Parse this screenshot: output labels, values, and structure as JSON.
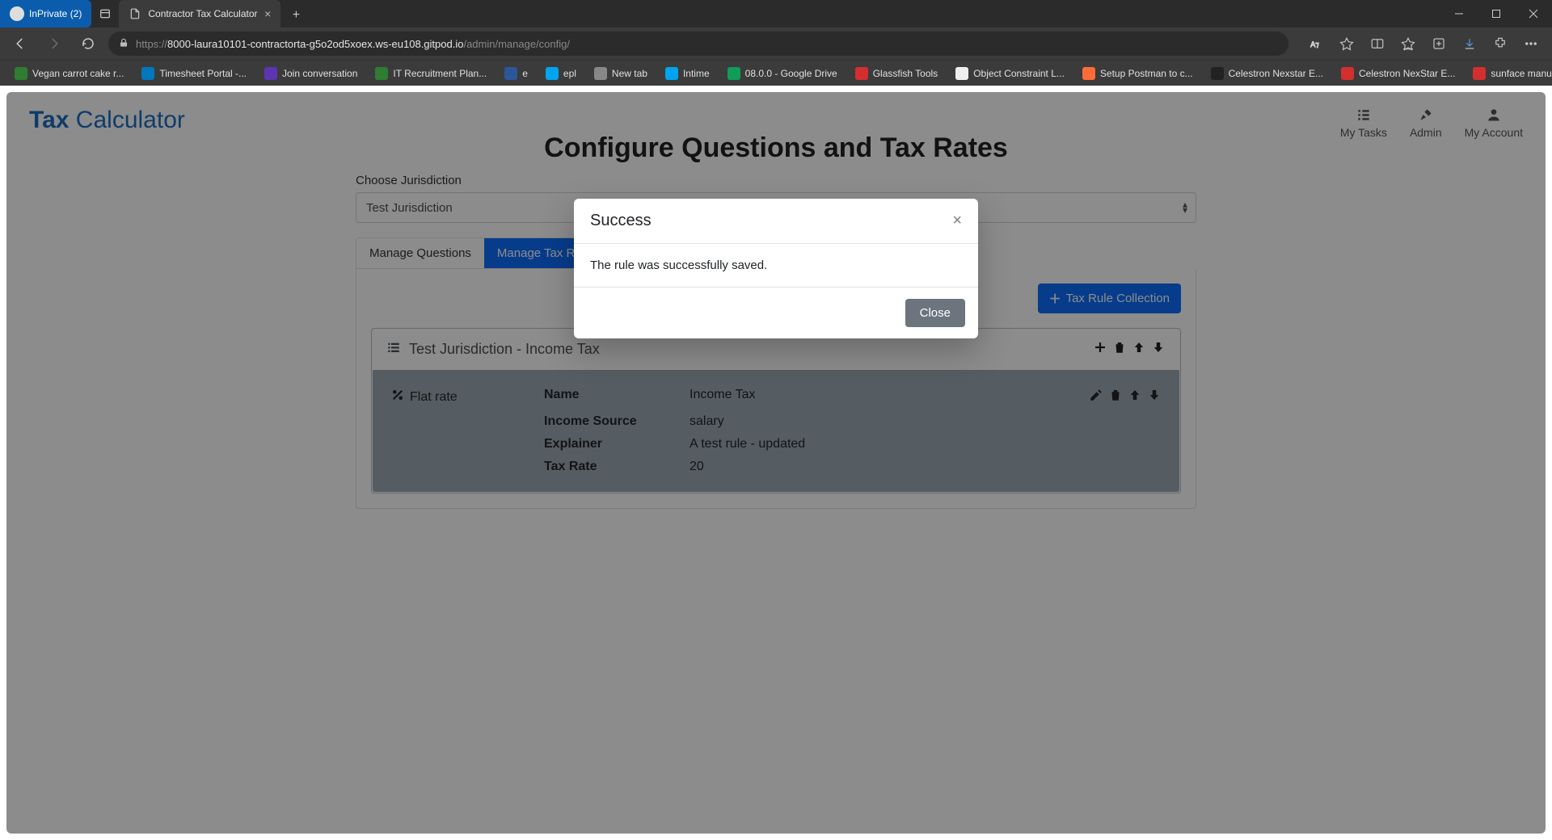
{
  "browser": {
    "inprivate_label": "InPrivate (2)",
    "tab_title": "Contractor Tax Calculator",
    "url_host": "8000-laura10101-contractorta-g5o2od5xoex.ws-eu108.gitpod.io",
    "url_path": "/admin/manage/config/",
    "url_scheme": "https://",
    "bookmarks": [
      {
        "label": "Vegan carrot cake r...",
        "color": "#2e7d32"
      },
      {
        "label": "Timesheet Portal -...",
        "color": "#0277bd"
      },
      {
        "label": "Join conversation",
        "color": "#5e35b1"
      },
      {
        "label": "IT Recruitment Plan...",
        "color": "#2e7d32"
      },
      {
        "label": "e",
        "color": "#2b579a"
      },
      {
        "label": "epl",
        "color": "#00a4ef"
      },
      {
        "label": "New tab",
        "color": "#888"
      },
      {
        "label": "Intime",
        "color": "#00a4ef"
      },
      {
        "label": "08.0.0 - Google Drive",
        "color": "#0f9d58"
      },
      {
        "label": "Glassfish Tools",
        "color": "#d32f2f"
      },
      {
        "label": "Object Constraint L...",
        "color": "#eeeeee"
      },
      {
        "label": "Setup Postman to c...",
        "color": "#ff6c37"
      },
      {
        "label": "Celestron Nexstar E...",
        "color": "#222"
      },
      {
        "label": "Celestron NexStar E...",
        "color": "#d32f2f"
      },
      {
        "label": "sunface manual",
        "color": "#d32f2f"
      }
    ]
  },
  "app": {
    "brand_bold": "Tax",
    "brand_rest": " Calculator",
    "header_nav": {
      "tasks": "My Tasks",
      "admin": "Admin",
      "account": "My Account"
    },
    "page_title": "Configure Questions and Tax Rates",
    "jurisdiction_label": "Choose Jurisdiction",
    "jurisdiction_value": "Test Jurisdiction",
    "tabs": {
      "questions": "Manage Questions",
      "rates": "Manage Tax Rates"
    },
    "add_collection_label": "Tax Rule Collection",
    "collection": {
      "title": "Test Jurisdiction - Income Tax",
      "rule": {
        "type_label": "Flat rate",
        "fields": {
          "name_label": "Name",
          "name_value": "Income Tax",
          "source_label": "Income Source",
          "source_value": "salary",
          "explainer_label": "Explainer",
          "explainer_value": "A test rule - updated",
          "taxrate_label": "Tax Rate",
          "taxrate_value": "20"
        }
      }
    }
  },
  "modal": {
    "title": "Success",
    "message": "The rule was successfully saved.",
    "close_label": "Close"
  }
}
